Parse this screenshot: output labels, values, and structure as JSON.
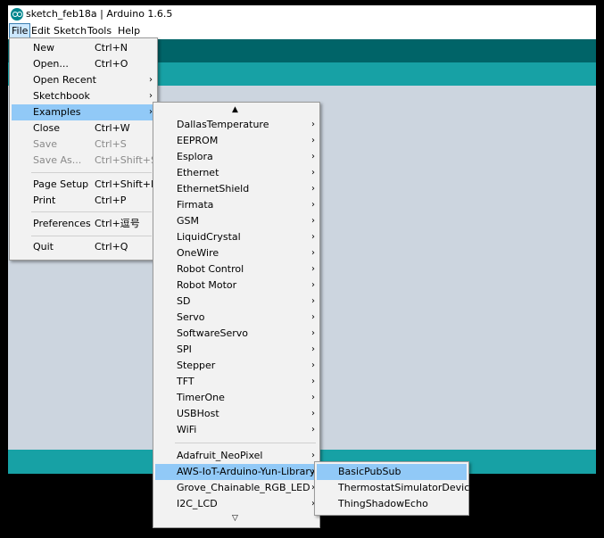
{
  "window": {
    "title": "sketch_feb18a | Arduino 1.6.5"
  },
  "menubar": [
    {
      "label": "File",
      "selected": true
    },
    {
      "label": "Edit"
    },
    {
      "label": "Sketch"
    },
    {
      "label": "Tools"
    },
    {
      "label": "Help"
    }
  ],
  "file_menu": [
    {
      "label": "New",
      "shortcut": "Ctrl+N"
    },
    {
      "label": "Open...",
      "shortcut": "Ctrl+O"
    },
    {
      "label": "Open Recent",
      "submenu": true
    },
    {
      "label": "Sketchbook",
      "submenu": true
    },
    {
      "label": "Examples",
      "submenu": true,
      "highlighted": true
    },
    {
      "label": "Close",
      "shortcut": "Ctrl+W"
    },
    {
      "label": "Save",
      "shortcut": "Ctrl+S",
      "disabled": true
    },
    {
      "label": "Save As...",
      "shortcut": "Ctrl+Shift+S",
      "disabled": true
    },
    {
      "label": "Page Setup",
      "shortcut": "Ctrl+Shift+P"
    },
    {
      "label": "Print",
      "shortcut": "Ctrl+P"
    },
    {
      "label": "Preferences",
      "shortcut": "Ctrl+逗号"
    },
    {
      "label": "Quit",
      "shortcut": "Ctrl+Q"
    }
  ],
  "examples_menu": {
    "scroll_up": "▲",
    "scroll_down": "▽",
    "items": [
      "DallasTemperature",
      "EEPROM",
      "Esplora",
      "Ethernet",
      "EthernetShield",
      "Firmata",
      "GSM",
      "LiquidCrystal",
      "OneWire",
      "Robot Control",
      "Robot Motor",
      "SD",
      "Servo",
      "SoftwareServo",
      "SPI",
      "Stepper",
      "TFT",
      "TimerOne",
      "USBHost",
      "WiFi"
    ],
    "extra_items": [
      "Adafruit_NeoPixel",
      "AWS-IoT-Arduino-Yun-Library",
      "Grove_Chainable_RGB_LED",
      "I2C_LCD"
    ],
    "highlighted": "AWS-IoT-Arduino-Yun-Library"
  },
  "aws_submenu": {
    "items": [
      "BasicPubSub",
      "ThermostatSimulatorDevice",
      "ThingShadowEcho"
    ],
    "highlighted": "BasicPubSub"
  },
  "icons": {
    "app": "arduino-logo-icon",
    "submenu": "chevron-right-icon"
  },
  "colors": {
    "toolbar": "#006468",
    "tabbar": "#17a1a5",
    "editor": "#ccd5df",
    "highlight": "#91c9f7"
  }
}
